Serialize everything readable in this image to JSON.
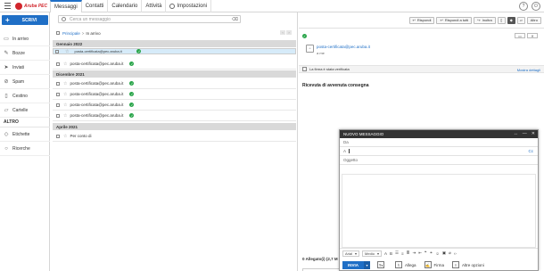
{
  "app": {
    "logo_text": "Aruba PEC",
    "brand_color": "#d1262c",
    "accent_color": "#1f6fc6"
  },
  "tabs": [
    {
      "label": "Messaggi",
      "active": true
    },
    {
      "label": "Contatti",
      "active": false
    },
    {
      "label": "Calendario",
      "active": false
    },
    {
      "label": "Attività",
      "active": false
    },
    {
      "label": "Impostazioni",
      "active": false
    }
  ],
  "topbar": {
    "help_glyph": "?",
    "power_glyph": "⏻"
  },
  "sidebar": {
    "compose_label": "SCRIVI",
    "items": [
      {
        "label": "In arrivo",
        "icon": "inbox-icon"
      },
      {
        "label": "Bozze",
        "icon": "draft-icon"
      },
      {
        "label": "Inviati",
        "icon": "sent-icon"
      },
      {
        "label": "Spam",
        "icon": "spam-icon"
      },
      {
        "label": "Cestino",
        "icon": "trash-icon"
      },
      {
        "label": "Cartelle",
        "icon": "folder-icon"
      }
    ],
    "section_label": "ALTRO",
    "extra_items": [
      {
        "label": "Etichette",
        "icon": "tag-icon"
      },
      {
        "label": "Ricerche",
        "icon": "search-icon"
      }
    ]
  },
  "list": {
    "search_placeholder": "Cerca un messaggio",
    "breadcrumb_root": "Principale",
    "breadcrumb_sep": ">",
    "breadcrumb_current": "In arrivo",
    "groups": [
      {
        "label": "Gennaio 2022",
        "rows": [
          "posta-certificata@pec.aruba.it",
          "posta-certificata@pec.aruba.it"
        ]
      },
      {
        "label": "Dicembre 2021",
        "rows": [
          "posta-certificata@pec.aruba.it",
          "posta-certificata@pec.aruba.it",
          "posta-certificata@pec.aruba.it",
          "posta-certificata@pec.aruba.it"
        ]
      },
      {
        "label": "Aprile 2021",
        "rows": [
          "Per conto di"
        ]
      }
    ]
  },
  "reader": {
    "buttons": {
      "reply": "Rispondi",
      "reply_all": "Rispondi a tutti",
      "forward": "Inoltra",
      "more": "Altro"
    },
    "sender_email": "posta-certificata@pec.aruba.it",
    "to_label": "a me",
    "notice": "La firma è stata verificata",
    "notice_link": "Mostra dettagli",
    "body_title": "Ricevuta di avvenuta consegna",
    "attachments": "0 Allegato(i) (2,7 M"
  },
  "composer": {
    "title": "NUOVO MESSAGGIO",
    "from_label": "Da",
    "to_label": "A",
    "cc_label": "Cc",
    "subject_label": "Oggetto",
    "font": "Arial",
    "size": "Medio",
    "send_label": "INVIA",
    "attach_label": "Allega",
    "sign_label": "Firma",
    "more_label": "Altre opzioni"
  }
}
